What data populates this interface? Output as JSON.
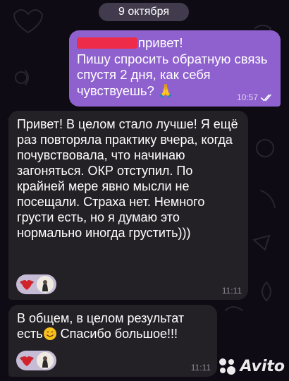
{
  "chat": {
    "date_separator": "9 октября",
    "messages": [
      {
        "direction": "outgoing",
        "text_after_name": "привет!\nПишу спросить обратную связь спустя 2 дня, как себя чувствуешь? 🙏",
        "time": "10:57",
        "status": "read"
      },
      {
        "direction": "incoming",
        "text": "Привет! В целом стало лучше! Я ещё раз повторяла практику вчера, когда почувствовала, что начинаю загоняться. ОКР отступил. По крайней мере явно мысли не посещали. Страха нет. Немного грусти есть, но я думаю это нормально иногда грустить)))",
        "time": "11:11",
        "reactions": [
          "heart-with-wings-icon",
          "user-avatar"
        ]
      },
      {
        "direction": "incoming",
        "text_before_emoji": "В общем, в целом результат есть",
        "emoji": "smiling-face-icon",
        "text_after_emoji": " Спасибо большое!!!",
        "time": "11:11",
        "reactions": [
          "heart-with-wings-icon",
          "user-avatar"
        ]
      }
    ]
  },
  "watermark": {
    "text": "Avito"
  },
  "colors": {
    "background": "#0e0b14",
    "outgoing_bubble": "#8e61cf",
    "incoming_bubble": "#232126",
    "reaction_pill": "#c6bcd6",
    "redaction": "#ee2c4a"
  }
}
